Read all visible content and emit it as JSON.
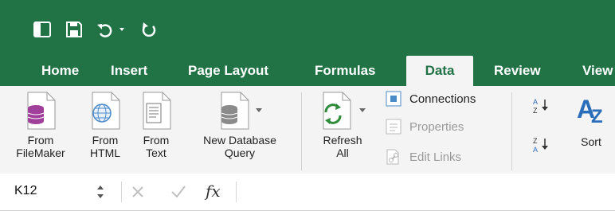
{
  "quick_access": {
    "icons": [
      "sidebar-toggle-icon",
      "save-icon",
      "undo-icon",
      "redo-icon"
    ]
  },
  "tabs": [
    {
      "label": "Home"
    },
    {
      "label": "Insert"
    },
    {
      "label": "Page Layout"
    },
    {
      "label": "Formulas"
    },
    {
      "label": "Data",
      "active": true
    },
    {
      "label": "Review"
    },
    {
      "label": "View"
    }
  ],
  "ribbon": {
    "from_filemaker": {
      "line1": "From",
      "line2": "FileMaker"
    },
    "from_html": {
      "line1": "From",
      "line2": "HTML"
    },
    "from_text": {
      "line1": "From",
      "line2": "Text"
    },
    "new_db_query": {
      "line1": "New Database",
      "line2": "Query"
    },
    "refresh_all": {
      "line1": "Refresh",
      "line2": "All"
    },
    "connections": "Connections",
    "properties": "Properties",
    "edit_links": "Edit Links",
    "sort": "Sort"
  },
  "formula_bar": {
    "name_box": "K12",
    "fx": "fx"
  },
  "colors": {
    "brand": "#217346",
    "ribbon_bg": "#f4f4f4"
  }
}
